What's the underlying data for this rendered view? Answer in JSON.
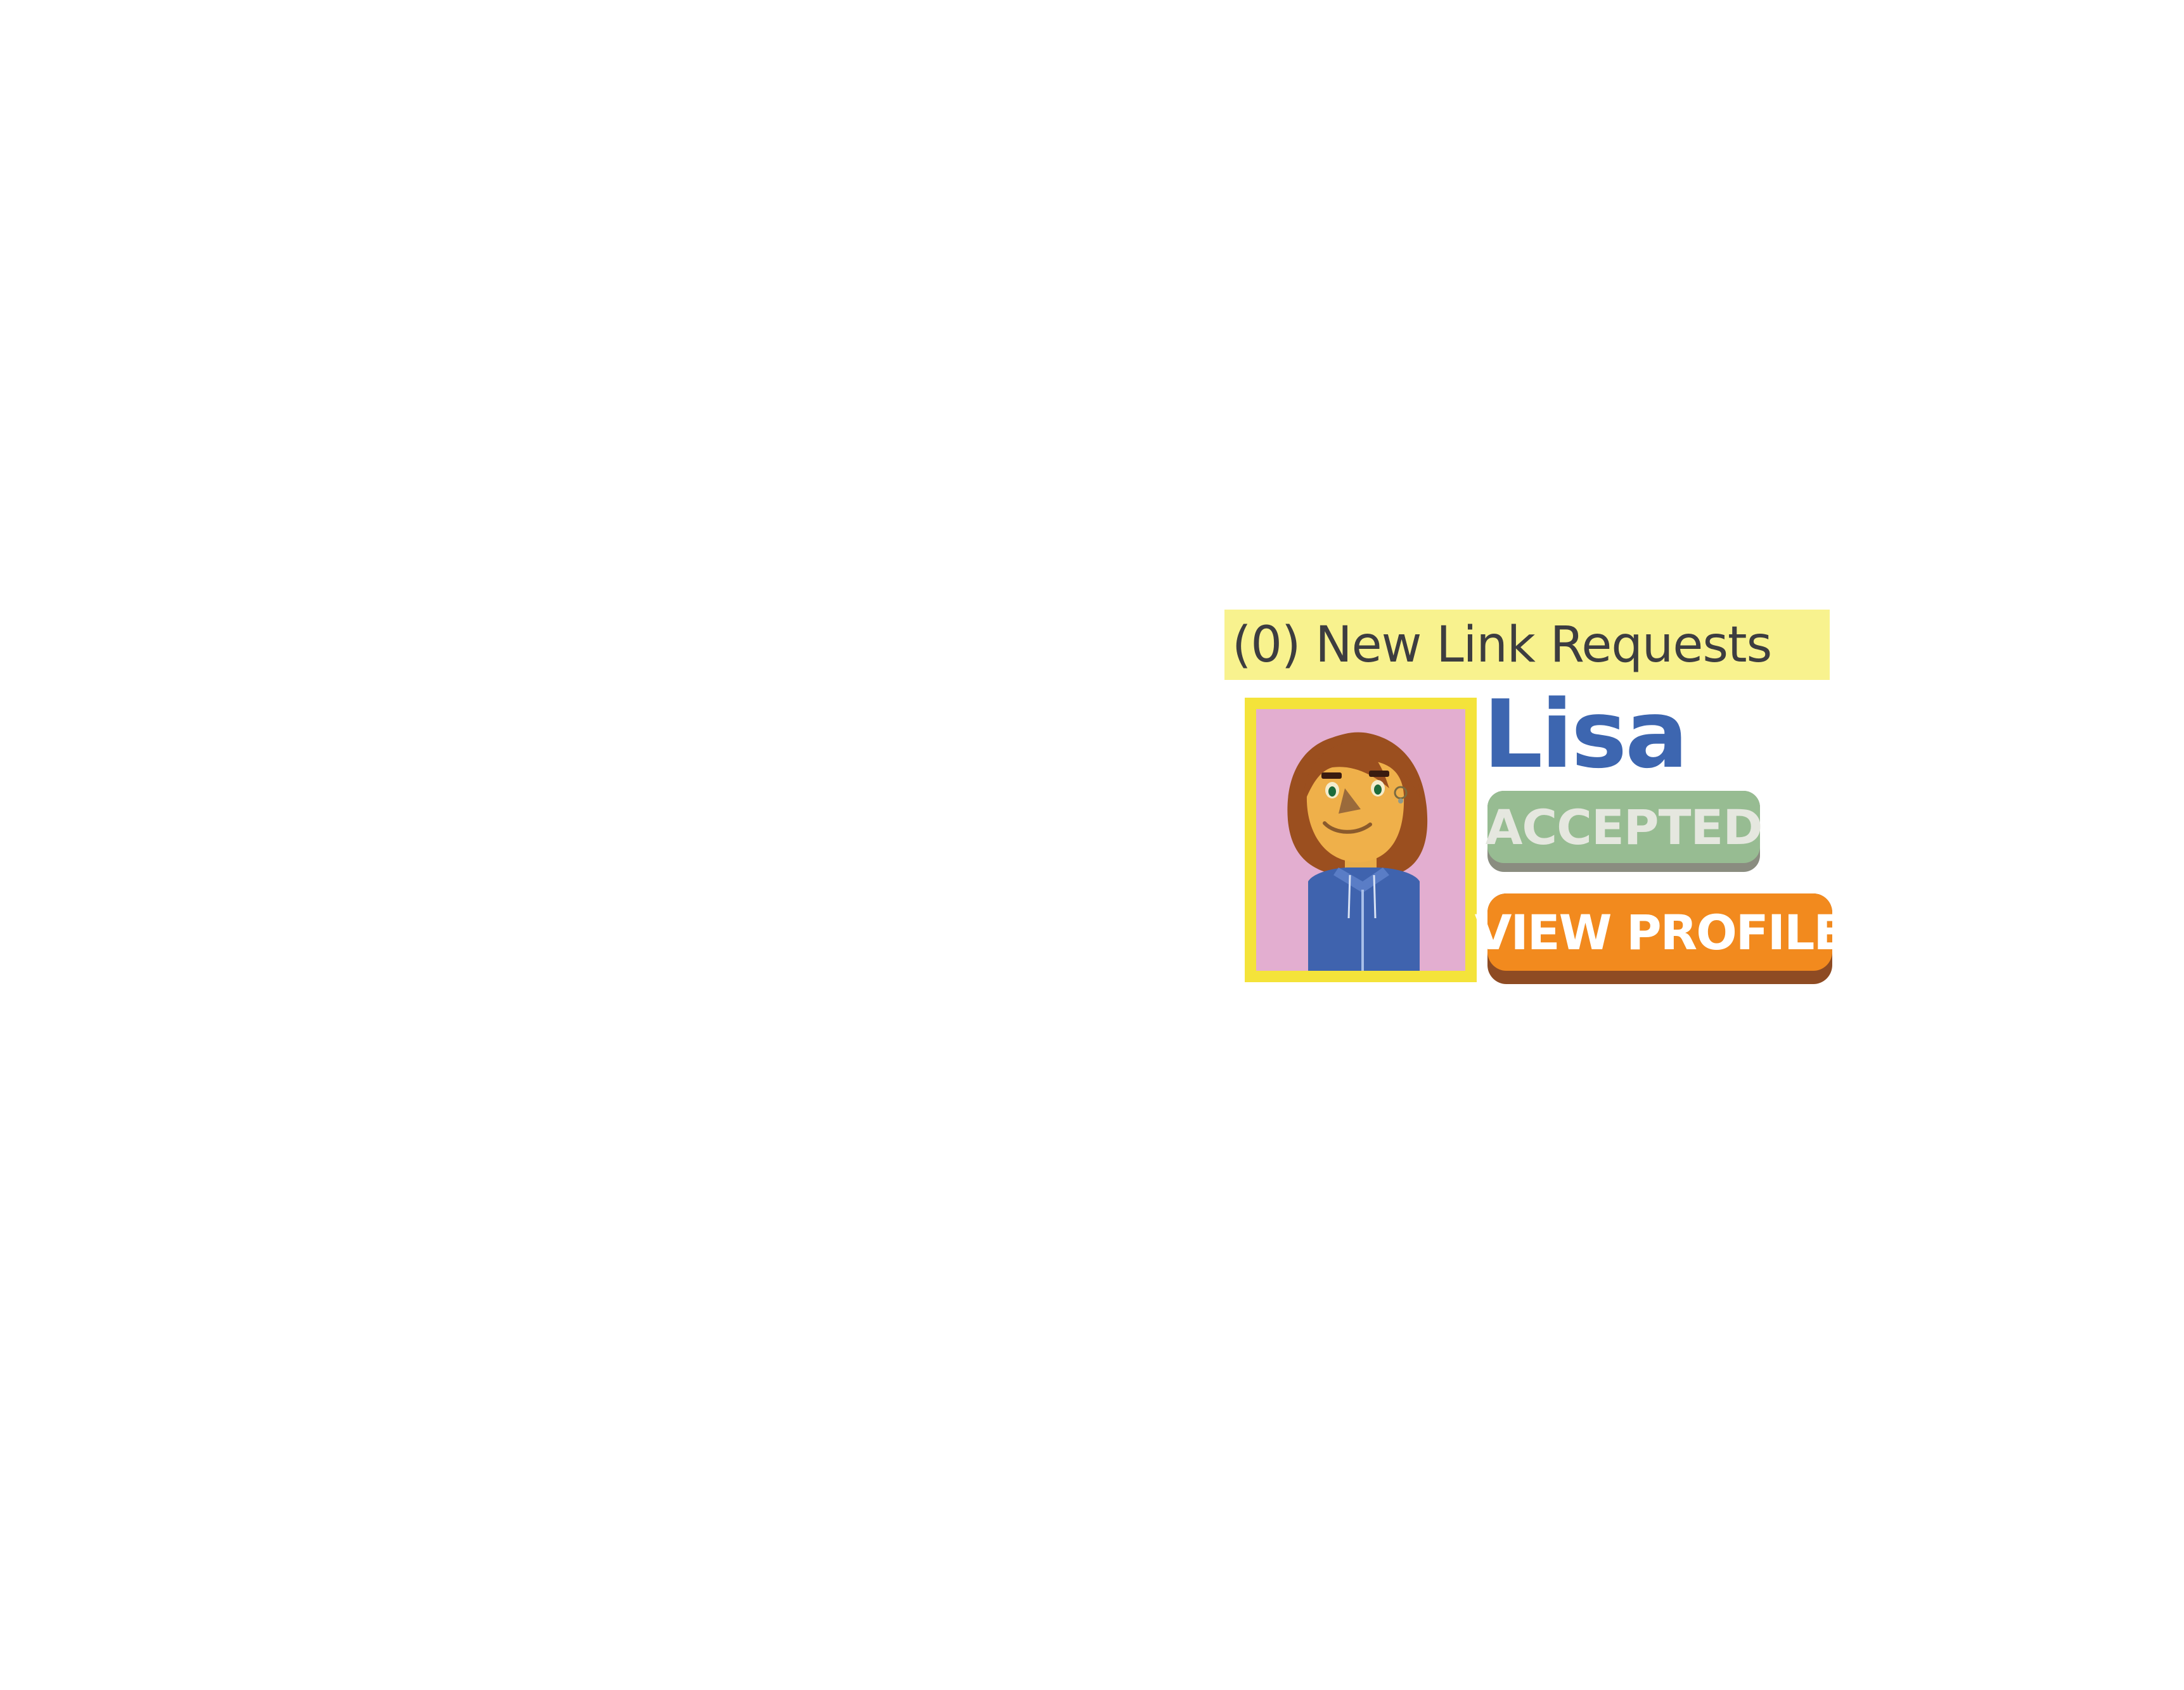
{
  "requests": {
    "label": "(0) New Link Requests"
  },
  "user": {
    "name": "Lisa",
    "avatar_icon": "avatar-portrait-icon"
  },
  "status": {
    "label": "ACCEPTED"
  },
  "actions": {
    "view_profile_label": "VIEW PROFILE"
  },
  "colors": {
    "banner": "#f8f28e",
    "name": "#3d66b0",
    "status_badge": "#97bc92",
    "view_profile_button": "#f28a1e",
    "avatar_frame": "#f4e33a",
    "avatar_background": "#e3aed0"
  }
}
